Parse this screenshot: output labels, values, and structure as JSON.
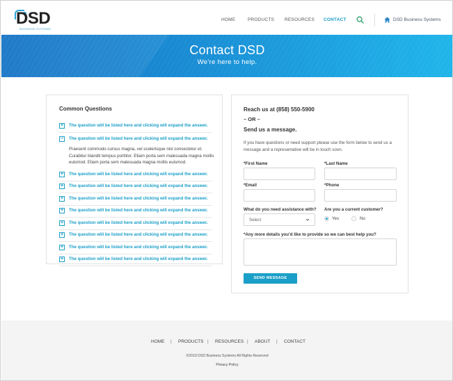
{
  "header": {
    "logo_text": "DSD",
    "logo_sub": "BUSINESS SYSTEMS",
    "nav": [
      {
        "label": "HOME",
        "active": false
      },
      {
        "label": "PRODUCTS",
        "active": false
      },
      {
        "label": "RESOURCES",
        "active": false
      },
      {
        "label": "CONTACT",
        "active": true
      }
    ],
    "company_link": "DSD Business Systems"
  },
  "hero": {
    "title": "Contact DSD",
    "subtitle": "We’re here to help."
  },
  "faq": {
    "title": "Common Questions",
    "question_text": "The question will be listed here and clicking will expand the answer.",
    "items": [
      {
        "expanded": false
      },
      {
        "expanded": true
      },
      {
        "expanded": false
      },
      {
        "expanded": false
      },
      {
        "expanded": false
      },
      {
        "expanded": false
      },
      {
        "expanded": false
      },
      {
        "expanded": false
      },
      {
        "expanded": false
      },
      {
        "expanded": false
      }
    ],
    "answer": "Praesent commodo cursus magna, vel scelerisque nisl consectetur et. Curabitur blandit tempus porttitor. Etiam porta sem malesuada magna mollis euismod. Etiam porta sem malesuada magna mollis euismod."
  },
  "form": {
    "reach": "Reach us at (858) 550-5900",
    "or": "– OR –",
    "send_title": "Send us a message.",
    "intro": "If you have questions or need support please use the form below to send us a message and a representative will be in touch soon.",
    "first_name_label": "*First Name",
    "last_name_label": "*Last Name",
    "email_label": "*Email",
    "phone_label": "*Phone",
    "assistance_label": "What do you need assistance with?",
    "assistance_value": "Select",
    "customer_label": "Are you a current customer?",
    "yes_label": "Yes",
    "no_label": "No",
    "customer_selected": "Yes",
    "details_label": "*Any more details you’d like to provide so we can best help you?",
    "send_button": "SEND MESSAGE"
  },
  "footer": {
    "nav": [
      "HOME",
      "PRODUCTS",
      "RESOURCES",
      "ABOUT",
      "CONTACT"
    ],
    "separator": "|",
    "copyright": "©2019 DSD Business Systems All Rights Reserved",
    "privacy": "Privacy Policy"
  },
  "colors": {
    "accent": "#1a9fc8",
    "hero_start": "#1271c4",
    "hero_end": "#20b6ea",
    "footer_bg": "#f4f4f4"
  },
  "icons": {
    "search": "search-icon",
    "home": "home-icon",
    "expand": "plus-icon",
    "collapse": "minus-icon",
    "select": "chevron-down-icon"
  }
}
